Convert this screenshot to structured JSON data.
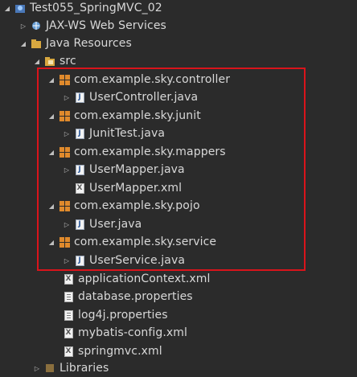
{
  "tree": {
    "project": {
      "label": "Test055_SpringMVC_02"
    },
    "jaxws": {
      "label": "JAX-WS Web Services"
    },
    "java_resources": {
      "label": "Java Resources"
    },
    "src": {
      "label": "src"
    },
    "packages": [
      {
        "label": "com.example.sky.controller",
        "files": [
          {
            "label": "UserController.java"
          }
        ]
      },
      {
        "label": "com.example.sky.junit",
        "files": [
          {
            "label": "JunitTest.java"
          }
        ]
      },
      {
        "label": "com.example.sky.mappers",
        "files": [
          {
            "label": "UserMapper.java"
          },
          {
            "label": "UserMapper.xml"
          }
        ]
      },
      {
        "label": "com.example.sky.pojo",
        "files": [
          {
            "label": "User.java"
          }
        ]
      },
      {
        "label": "com.example.sky.service",
        "files": [
          {
            "label": "UserService.java"
          }
        ]
      }
    ],
    "src_files": [
      {
        "label": "applicationContext.xml"
      },
      {
        "label": "database.properties"
      },
      {
        "label": "log4j.properties"
      },
      {
        "label": "mybatis-config.xml"
      },
      {
        "label": "springmvc.xml"
      }
    ],
    "libraries": {
      "label": "Libraries"
    }
  },
  "colors": {
    "highlight_border": "#d9141b",
    "package_icon": "#e08a2c",
    "java_icon": "#2d5a9b"
  },
  "icons": {
    "expanded": "triangle-down",
    "collapsed": "triangle-right"
  }
}
